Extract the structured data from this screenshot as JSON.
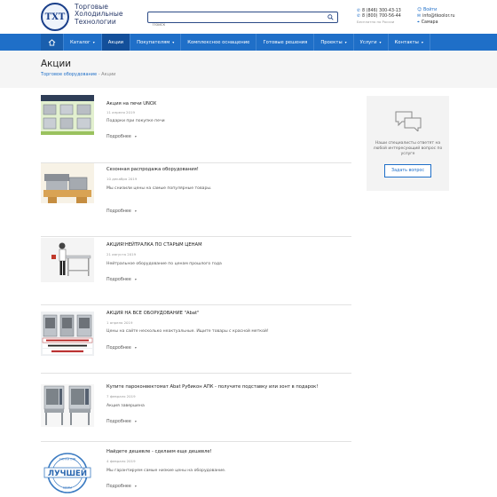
{
  "header": {
    "logo_text": "ТХТ",
    "company_line1": "Торговые",
    "company_line2": "Холодильные",
    "company_line3": "Технологии",
    "search_placeholder": "Поиск",
    "phone1": "8 (846) 300-43-13",
    "phone2": "8 (800) 700-56-44",
    "phone_hint": "Бесплатно по России",
    "login": "Войти",
    "email": "info@tkoolor.ru",
    "city": "Самара"
  },
  "nav": {
    "items": [
      {
        "label": "Каталог",
        "chevron": true
      },
      {
        "label": "Акции",
        "chevron": false
      },
      {
        "label": "Покупателям",
        "chevron": true
      },
      {
        "label": "Комплексное оснащение",
        "chevron": false
      },
      {
        "label": "Готовые решения",
        "chevron": false
      },
      {
        "label": "Проекты",
        "chevron": true
      },
      {
        "label": "Услуги",
        "chevron": true
      },
      {
        "label": "Контакты",
        "chevron": true
      }
    ]
  },
  "page": {
    "title": "Акции",
    "breadcrumb_link": "Торговое оборудование",
    "breadcrumb_sep": " - ",
    "breadcrumb_current": "Акции"
  },
  "promos": [
    {
      "title": "Акция на печи UNOX",
      "date": "11 апреля 2019",
      "desc": "Подарки при покупке печи",
      "more": "Подробнее"
    },
    {
      "title": "Сезонная распродажа оборудования!",
      "date": "10 декабря 2019",
      "desc": "Мы снизили цены на самые популярные товары.",
      "more": "Подробнее"
    },
    {
      "title": "АКЦИЯ!НЕЙТРАЛКА ПО СТАРЫМ ЦЕНАМ",
      "date": "21 августа 2019",
      "desc": "Нейтральное оборудование по ценам прошлого года",
      "more": "Подробнее"
    },
    {
      "title": "АКЦИЯ НА ВСЕ ОБОРУДОВАНИЕ \"Abat\"",
      "date": "1 апреля 2019",
      "desc": "Цены на сайте несколько неактуальные. Ищите товары с красной меткой!",
      "more": "Подробнее"
    },
    {
      "title": "Купите пароконвектомат Abat Рубикон АПК - получите подставку или зонт в подарок!",
      "date": "7 февраля 2019",
      "desc": "Акция завершена",
      "more": "Подробнее"
    },
    {
      "title": "Найдете дешевле - сделаем еще дешевле!",
      "date": "4 февраля 2019",
      "desc": "Мы гарантируем самые низкие цены на оборудование.",
      "more": "Подробнее"
    }
  ],
  "sidebar": {
    "text_line1": "Наши специалисты ответят на",
    "text_line2": "любой интересующий вопрос по",
    "text_line3": "услуге",
    "button": "Задать вопрос"
  },
  "badge": {
    "ring_top": "ГАРАНТИЯ",
    "word": "ЛУЧШЕЙ",
    "ring_bottom": "ЦЕНЫ"
  },
  "colors": {
    "brand": "#1f6fc8",
    "nav_active": "#134f9a"
  }
}
